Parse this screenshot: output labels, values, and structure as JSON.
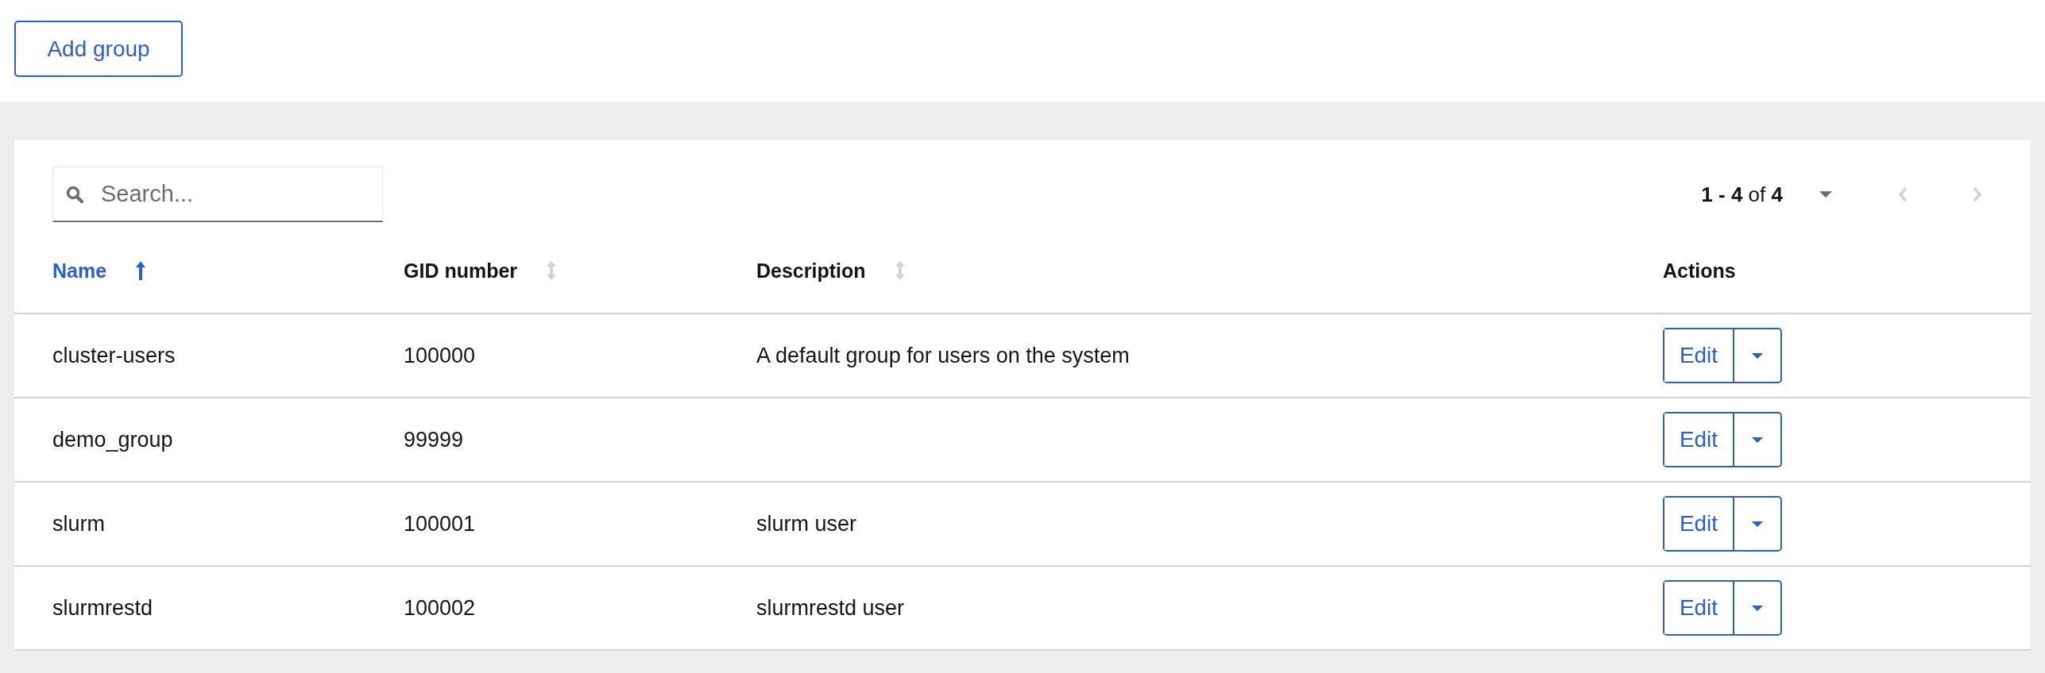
{
  "toolbar": {
    "add_button": "Add group"
  },
  "search": {
    "placeholder": "Search..."
  },
  "pagination": {
    "label": "**1 - 4** of **4**",
    "prev_disabled": true,
    "next_disabled": true
  },
  "table": {
    "columns": [
      {
        "label": "Name",
        "sorted": true
      },
      {
        "label": "GID number",
        "sorted": false
      },
      {
        "label": "Description",
        "sorted": false
      },
      {
        "label": "Actions"
      }
    ],
    "rows": [
      {
        "name": "cluster-users",
        "gid": "100000",
        "description": "A default group for users on the system",
        "action": "Edit"
      },
      {
        "name": "demo_group",
        "gid": "99999",
        "action": "Edit"
      },
      {
        "name": "slurm",
        "gid": "100001",
        "description": "slurm user",
        "action": "Edit"
      },
      {
        "name": "slurmrestd",
        "gid": "100002",
        "description": "slurmrestd user",
        "action": "Edit"
      }
    ]
  }
}
